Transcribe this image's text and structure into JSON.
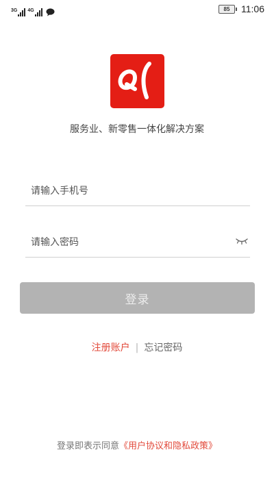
{
  "status_bar": {
    "network1": "3G",
    "network2": "4G",
    "battery": "85",
    "time": "11:06"
  },
  "logo_icon": "qi-logo",
  "tagline": "服务业、新零售一体化解决方案",
  "form": {
    "phone_placeholder": "请输入手机号",
    "password_placeholder": "请输入密码",
    "login_label": "登录"
  },
  "links": {
    "register": "注册账户",
    "divider": "|",
    "forgot": "忘记密码"
  },
  "agreement": {
    "prefix": "登录即表示同意",
    "link": "《用户协议和隐私政策》"
  },
  "colors": {
    "brand": "#e41e15",
    "link": "#e24a3b",
    "button_disabled": "#b3b3b3"
  }
}
